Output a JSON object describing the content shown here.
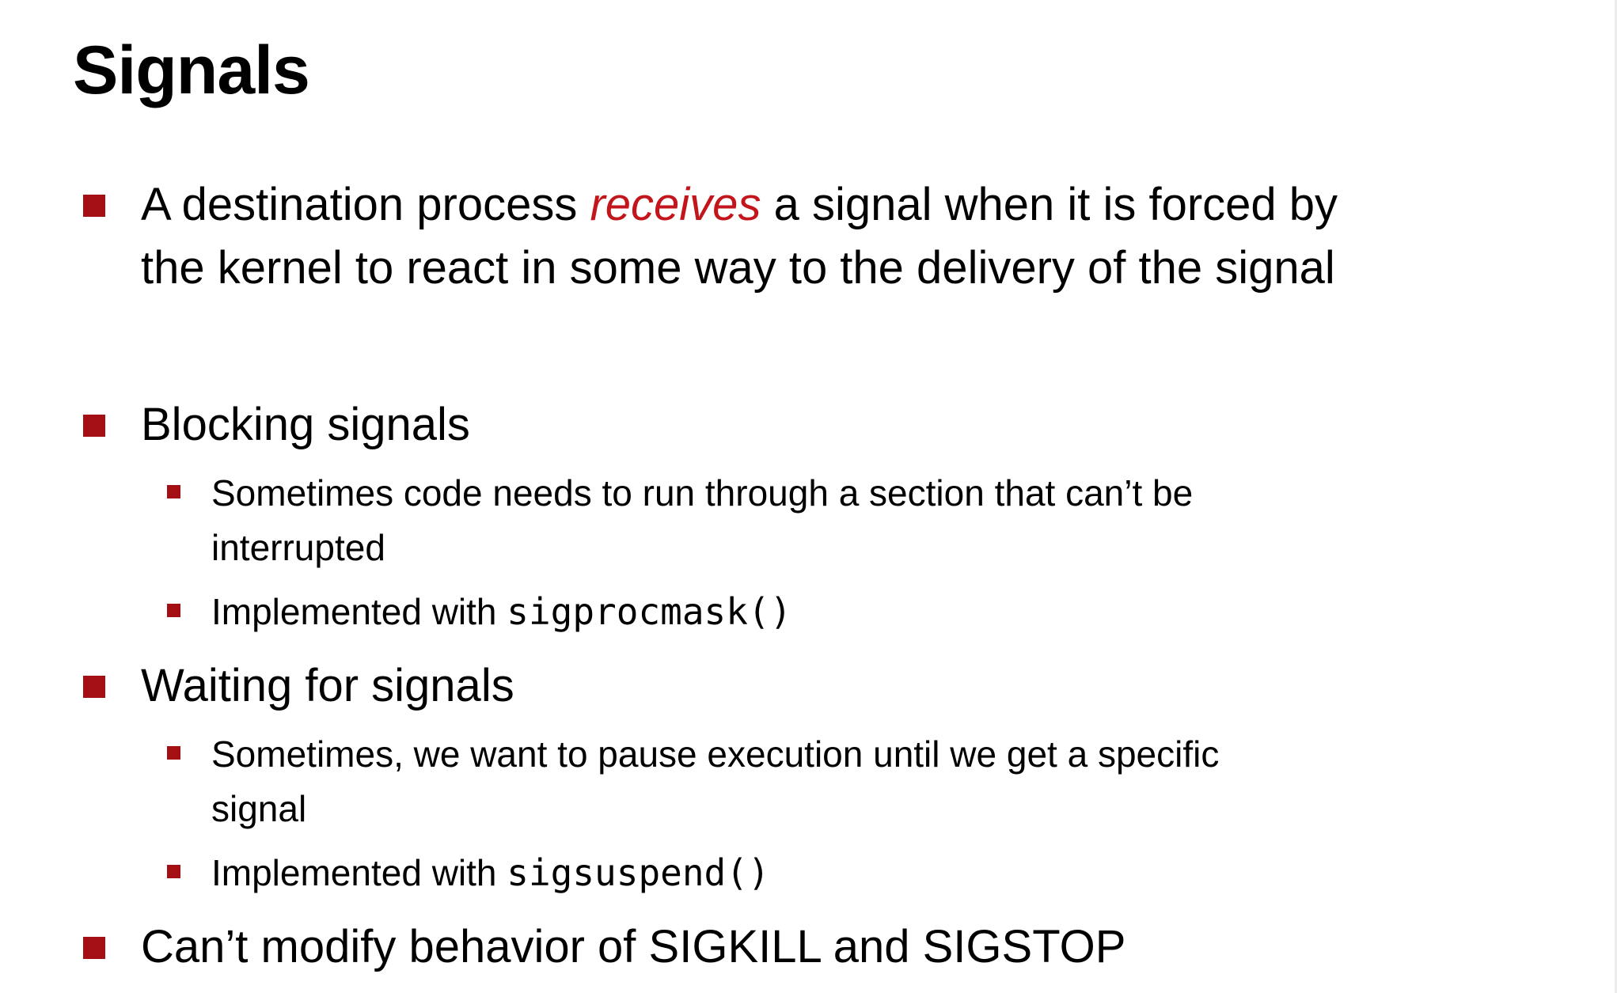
{
  "slide": {
    "title": "Signals",
    "bullets": [
      {
        "line1_before": "A destination process ",
        "line1_emph": "receives",
        "line1_after": " a signal when it is forced by",
        "line2": "the kernel to react in some way to the delivery of the signal"
      },
      {
        "text": "Blocking signals",
        "sub": [
          {
            "line1": "Sometimes code needs to run through a section that can’t be",
            "line2": "interrupted"
          },
          {
            "prefix": "Implemented with ",
            "code": "sigprocmask()"
          }
        ]
      },
      {
        "text": "Waiting for signals",
        "sub": [
          {
            "line1": "Sometimes, we want to pause execution until we get a specific",
            "line2": "signal"
          },
          {
            "prefix": "Implemented with ",
            "code": "sigsuspend()"
          }
        ]
      },
      {
        "text": "Can’t modify behavior of SIGKILL and SIGSTOP"
      }
    ],
    "colors": {
      "bullet": "#a30f12",
      "emphasis": "#c3161c",
      "text": "#000000",
      "background": "#ffffff"
    }
  }
}
